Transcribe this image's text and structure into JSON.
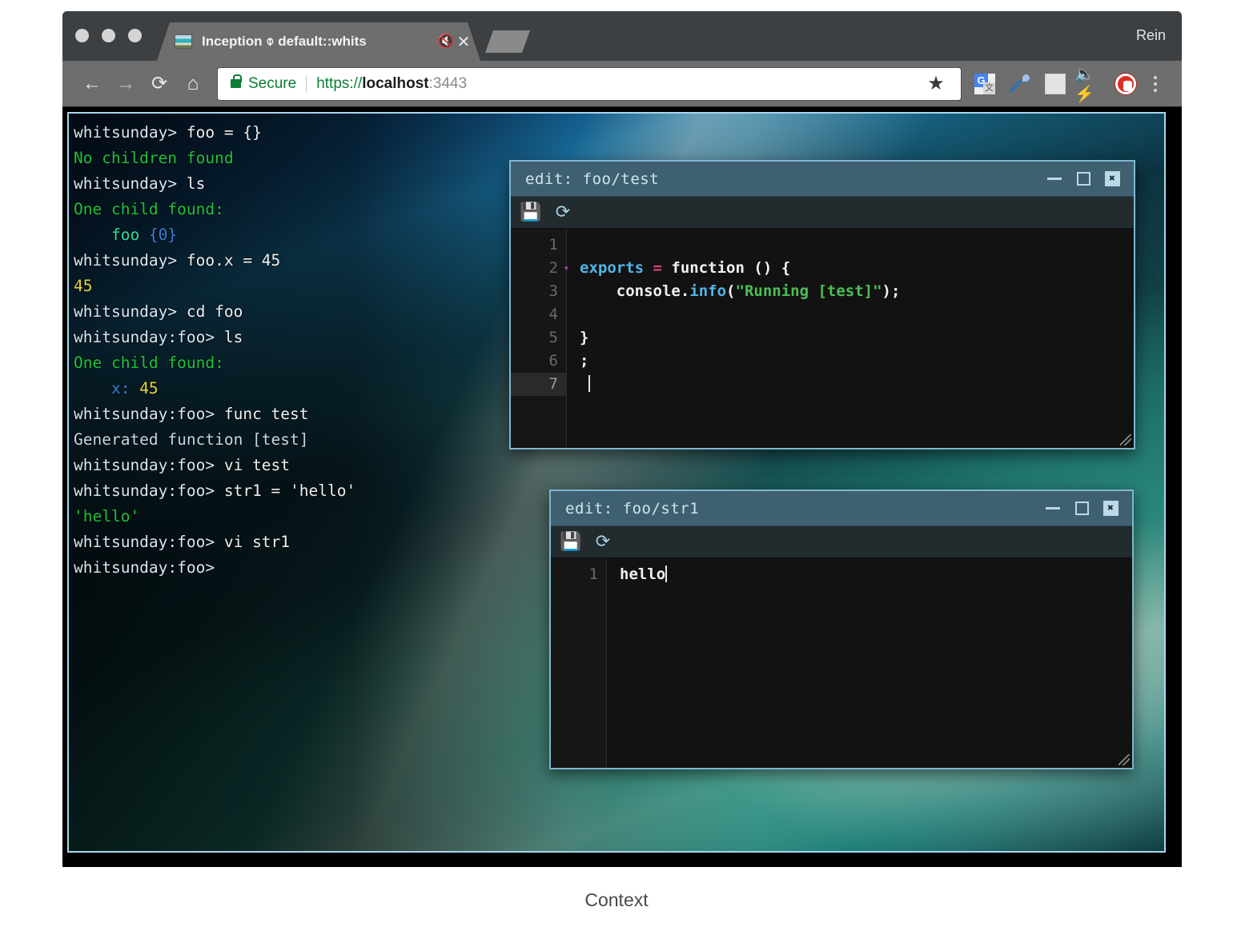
{
  "browser": {
    "profile_name": "Rein",
    "tab": {
      "title": "Inception ⌽ default::whits",
      "mute_icon": "muted-speaker-icon",
      "close_icon": "close-icon",
      "favicon": "beach-thumbnail-favicon"
    },
    "nav": {
      "back_icon": "back-arrow-icon",
      "forward_icon": "forward-arrow-icon",
      "reload_icon": "reload-icon",
      "home_icon": "home-icon"
    },
    "omnibox": {
      "security_label": "Secure",
      "lock_icon": "lock-icon",
      "url_scheme": "https://",
      "url_host": "localhost",
      "url_port": ":3443",
      "full_url": "https://localhost:3443",
      "star_icon": "★"
    },
    "extensions": [
      {
        "name": "google-translate-extension"
      },
      {
        "name": "color-picker-extension"
      },
      {
        "name": "image-graph-extension"
      },
      {
        "name": "mute-tab-extension",
        "glyph": "⚡"
      },
      {
        "name": "adblock-extension"
      }
    ],
    "menu_icon": "kebab-menu-icon"
  },
  "terminal": {
    "lines": [
      [
        {
          "t": "whitsunday> ",
          "c": "t-prompt"
        },
        {
          "t": "foo = {}",
          "c": "t-white"
        }
      ],
      [
        {
          "t": "No children found",
          "c": "t-green"
        }
      ],
      [
        {
          "t": "whitsunday> ",
          "c": "t-prompt"
        },
        {
          "t": "ls",
          "c": "t-white"
        }
      ],
      [
        {
          "t": "One child found:",
          "c": "t-green"
        }
      ],
      [
        {
          "t": "    foo ",
          "c": "t-cyan"
        },
        {
          "t": "{0}",
          "c": "t-blue"
        }
      ],
      [
        {
          "t": "whitsunday> ",
          "c": "t-prompt"
        },
        {
          "t": "foo.x = 45",
          "c": "t-white"
        }
      ],
      [
        {
          "t": "45",
          "c": "t-yellow"
        }
      ],
      [
        {
          "t": "whitsunday> ",
          "c": "t-prompt"
        },
        {
          "t": "cd foo",
          "c": "t-white"
        }
      ],
      [
        {
          "t": "whitsunday:foo> ",
          "c": "t-prompt"
        },
        {
          "t": "ls",
          "c": "t-white"
        }
      ],
      [
        {
          "t": "One child found:",
          "c": "t-green"
        }
      ],
      [
        {
          "t": "    x: ",
          "c": "t-blue"
        },
        {
          "t": "45",
          "c": "t-yellow"
        }
      ],
      [
        {
          "t": "whitsunday:foo> ",
          "c": "t-prompt"
        },
        {
          "t": "func test",
          "c": "t-white"
        }
      ],
      [
        {
          "t": "Generated function [test]",
          "c": "t-pale"
        }
      ],
      [
        {
          "t": "whitsunday:foo> ",
          "c": "t-prompt"
        },
        {
          "t": "vi test",
          "c": "t-white"
        }
      ],
      [
        {
          "t": "whitsunday:foo> ",
          "c": "t-prompt"
        },
        {
          "t": "str1 = 'hello'",
          "c": "t-white"
        }
      ],
      [
        {
          "t": "'hello'",
          "c": "t-green"
        }
      ],
      [
        {
          "t": "whitsunday:foo> ",
          "c": "t-prompt"
        },
        {
          "t": "vi str1",
          "c": "t-white"
        }
      ],
      [
        {
          "t": "whitsunday:foo>",
          "c": "t-prompt"
        }
      ]
    ]
  },
  "editor_test": {
    "title": "edit: foo/test",
    "toolbar": {
      "save_icon": "💾",
      "refresh_icon": "⟳"
    },
    "controls": {
      "minimize": "minimize-icon",
      "maximize": "maximize-icon",
      "close": "✖"
    },
    "line_numbers": [
      "1",
      "2",
      "3",
      "4",
      "5",
      "6",
      "7"
    ],
    "active_line": 7,
    "fold_line": 2,
    "fold_glyph": "▾",
    "code_lines": [
      [],
      [
        {
          "t": "exports",
          "c": "c-var"
        },
        {
          "t": " ",
          "c": "c-pl"
        },
        {
          "t": "=",
          "c": "c-op"
        },
        {
          "t": " function () {",
          "c": "c-kw"
        }
      ],
      [
        {
          "t": "    console.",
          "c": "c-pl"
        },
        {
          "t": "info",
          "c": "c-fn"
        },
        {
          "t": "(",
          "c": "c-pl"
        },
        {
          "t": "\"Running [test]\"",
          "c": "c-str"
        },
        {
          "t": ");",
          "c": "c-pl"
        }
      ],
      [],
      [
        {
          "t": "}",
          "c": "c-pl"
        }
      ],
      [
        {
          "t": ";",
          "c": "c-pl"
        }
      ],
      []
    ]
  },
  "editor_str1": {
    "title": "edit: foo/str1",
    "toolbar": {
      "save_icon": "💾",
      "refresh_icon": "⟳"
    },
    "controls": {
      "minimize": "minimize-icon",
      "maximize": "maximize-icon",
      "close": "✖"
    },
    "line_numbers": [
      "1"
    ],
    "code_lines": [
      [
        {
          "t": "hello",
          "c": "c-pl"
        }
      ]
    ]
  },
  "caption": "Context"
}
